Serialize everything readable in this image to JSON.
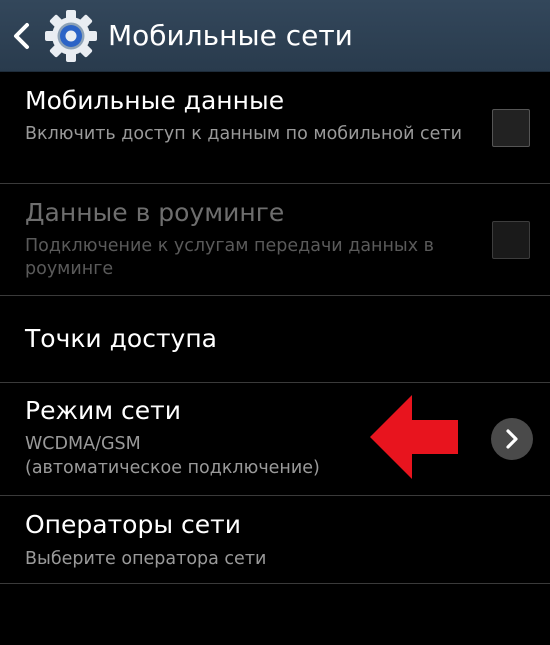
{
  "action_bar": {
    "title": "Мобильные сети",
    "back_icon": "chevron-left-icon",
    "app_icon": "gear-icon",
    "background": "#2f4356"
  },
  "items": [
    {
      "title": "Мобильные данные",
      "summary": "Включить доступ к данным по мобильной сети",
      "control": "checkbox",
      "checked": false,
      "enabled": true
    },
    {
      "title": "Данные в роуминге",
      "summary": "Подключение к услугам передачи данных в роуминге",
      "control": "checkbox",
      "checked": false,
      "enabled": false
    },
    {
      "title": "Точки доступа",
      "enabled": true
    },
    {
      "title": "Режим сети",
      "summary_line1": "WCDMA/GSM",
      "summary_line2": "(автоматическое подключение)",
      "control": "chevron-right-icon",
      "enabled": true
    },
    {
      "title": "Операторы сети",
      "summary": "Выберите оператора сети",
      "enabled": true
    }
  ],
  "annotation": {
    "icon": "red-arrow-left-icon",
    "color": "#e8141e"
  }
}
